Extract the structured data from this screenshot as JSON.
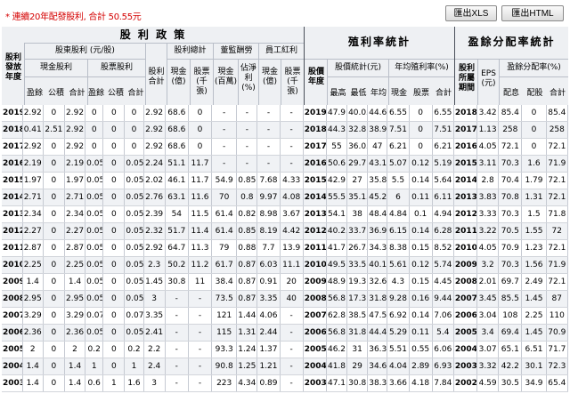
{
  "note": "* 連續20年配發股利, 合計 50.55元",
  "buttons": {
    "xls": "匯出XLS",
    "html": "匯出HTML"
  },
  "header": {
    "dividend": {
      "title": "股 利 政 策",
      "year": "股利發放年度",
      "shareholder": "股東股利 (元/股)",
      "cash": "現金股利",
      "stock": "股票股利",
      "surplus": "盈餘",
      "reserve": "公積",
      "total": "合計",
      "stock_total": "股利合計",
      "summary": "股利總計",
      "cash_amt": "現金(億)",
      "stock_amt": "股票(千張)",
      "director": "董監酬勞",
      "director_cash": "現金(百萬)",
      "director_ratio": "佔淨利(%)",
      "employee": "員工紅利",
      "employee_cash": "現金(億)",
      "employee_stock": "股票(千張)"
    },
    "yield": {
      "title": "殖利率統計",
      "year": "股價年度",
      "price_stats": "股價統計(元)",
      "high": "最高",
      "low": "最低",
      "avg": "年均",
      "avg_yield": "年均殖利率(%)",
      "cash": "現金",
      "stock": "股票",
      "total": "合計"
    },
    "payout": {
      "title": "盈餘分配率統計",
      "year": "股利所屬期間",
      "eps": "EPS (元)",
      "ratio": "盈餘分配率(%)",
      "cash": "配息",
      "stock": "配股",
      "total": "合計"
    }
  },
  "rows": [
    [
      "2019",
      "2.92",
      "0",
      "2.92",
      "0",
      "0",
      "0",
      "2.92",
      "68.6",
      "0",
      "-",
      "-",
      "-",
      "-",
      "2019",
      "47.9",
      "40.05",
      "44.6",
      "6.55",
      "0",
      "6.55",
      "2018",
      "3.42",
      "85.4",
      "0",
      "85.4"
    ],
    [
      "2018",
      "0.41",
      "2.51",
      "2.92",
      "0",
      "0",
      "0",
      "2.92",
      "68.6",
      "0",
      "-",
      "-",
      "-",
      "-",
      "2018",
      "44.3",
      "32.8",
      "38.9",
      "7.51",
      "0",
      "7.51",
      "2017",
      "1.13",
      "258",
      "0",
      "258"
    ],
    [
      "2017",
      "2.92",
      "0",
      "2.92",
      "0",
      "0",
      "0",
      "2.92",
      "68.6",
      "0",
      "-",
      "-",
      "-",
      "-",
      "2017",
      "55",
      "36.05",
      "47",
      "6.21",
      "0",
      "6.21",
      "2016",
      "4.05",
      "72.1",
      "0",
      "72.1"
    ],
    [
      "2016",
      "2.19",
      "0",
      "2.19",
      "0.05",
      "0",
      "0.05",
      "2.24",
      "51.1",
      "11.7",
      "-",
      "-",
      "-",
      "-",
      "2016",
      "50.6",
      "29.7",
      "43.1",
      "5.07",
      "0.12",
      "5.19",
      "2015",
      "3.11",
      "70.3",
      "1.6",
      "71.9"
    ],
    [
      "2015",
      "1.97",
      "0",
      "1.97",
      "0.05",
      "0",
      "0.05",
      "2.02",
      "46.1",
      "11.7",
      "54.9",
      "0.85",
      "7.68",
      "4.33",
      "2015",
      "42.9",
      "27",
      "35.8",
      "5.5",
      "0.14",
      "5.64",
      "2014",
      "2.8",
      "70.4",
      "1.79",
      "72.1"
    ],
    [
      "2014",
      "2.71",
      "0",
      "2.71",
      "0.05",
      "0",
      "0.05",
      "2.76",
      "63.1",
      "11.6",
      "70",
      "0.8",
      "9.97",
      "4.08",
      "2014",
      "55.5",
      "35.15",
      "45.2",
      "6",
      "0.11",
      "6.11",
      "2013",
      "3.83",
      "70.8",
      "1.31",
      "72.1"
    ],
    [
      "2013",
      "2.34",
      "0",
      "2.34",
      "0.05",
      "0",
      "0.05",
      "2.39",
      "54",
      "11.5",
      "61.4",
      "0.82",
      "8.98",
      "3.67",
      "2013",
      "54.1",
      "38",
      "48.4",
      "4.84",
      "0.1",
      "4.94",
      "2012",
      "3.33",
      "70.3",
      "1.5",
      "71.8"
    ],
    [
      "2012",
      "2.27",
      "0",
      "2.27",
      "0.05",
      "0",
      "0.05",
      "2.32",
      "51.7",
      "11.4",
      "61.4",
      "0.85",
      "8.19",
      "4.42",
      "2012",
      "40.25",
      "33.7",
      "36.9",
      "6.15",
      "0.14",
      "6.28",
      "2011",
      "3.22",
      "70.5",
      "1.55",
      "72"
    ],
    [
      "2011",
      "2.87",
      "0",
      "2.87",
      "0.05",
      "0",
      "0.05",
      "2.92",
      "64.7",
      "11.3",
      "79",
      "0.88",
      "7.7",
      "13.9",
      "2011",
      "41.7",
      "26.75",
      "34.3",
      "8.38",
      "0.15",
      "8.52",
      "2010",
      "4.05",
      "70.9",
      "1.23",
      "72.1"
    ],
    [
      "2010",
      "2.25",
      "0",
      "2.25",
      "0.05",
      "0",
      "0.05",
      "2.3",
      "50.2",
      "11.2",
      "61.7",
      "0.87",
      "6.03",
      "11.1",
      "2010",
      "49.5",
      "33.5",
      "40.1",
      "5.61",
      "0.12",
      "5.74",
      "2009",
      "3.2",
      "70.3",
      "1.56",
      "71.9"
    ],
    [
      "2009",
      "1.4",
      "0",
      "1.4",
      "0.05",
      "0",
      "0.05",
      "1.45",
      "30.8",
      "11",
      "38.4",
      "0.87",
      "0.91",
      "20",
      "2009",
      "48.9",
      "19.3",
      "32.6",
      "4.3",
      "0.15",
      "4.45",
      "2008",
      "2.01",
      "69.7",
      "2.49",
      "72.1"
    ],
    [
      "2008",
      "2.95",
      "0",
      "2.95",
      "0.05",
      "0",
      "0.05",
      "3",
      "-",
      "-",
      "73.5",
      "0.87",
      "3.35",
      "40",
      "2008",
      "56.8",
      "17.3",
      "31.8",
      "9.28",
      "0.16",
      "9.44",
      "2007",
      "3.45",
      "85.5",
      "1.45",
      "87"
    ],
    [
      "2007",
      "3.29",
      "0",
      "3.29",
      "0.07",
      "0",
      "0.07",
      "3.35",
      "-",
      "-",
      "121",
      "1.44",
      "4.06",
      "-",
      "2007",
      "62.8",
      "38.5",
      "47.5",
      "6.92",
      "0.14",
      "7.06",
      "2006",
      "3.04",
      "108",
      "2.25",
      "110"
    ],
    [
      "2006",
      "2.36",
      "0",
      "2.36",
      "0.05",
      "0",
      "0.05",
      "2.41",
      "-",
      "-",
      "115",
      "1.31",
      "2.44",
      "-",
      "2006",
      "56.8",
      "31.8",
      "44.4",
      "5.29",
      "0.11",
      "5.4",
      "2005",
      "3.4",
      "69.4",
      "1.45",
      "70.9"
    ],
    [
      "2005",
      "2",
      "0",
      "2",
      "0.2",
      "0",
      "0.2",
      "2.2",
      "-",
      "-",
      "93.3",
      "1.24",
      "1.37",
      "-",
      "2005",
      "46.2",
      "31",
      "36.3",
      "5.51",
      "0.55",
      "6.06",
      "2004",
      "3.07",
      "65.1",
      "6.51",
      "71.7"
    ],
    [
      "2004",
      "1.4",
      "0",
      "1.4",
      "1",
      "0",
      "1",
      "2.4",
      "-",
      "-",
      "90.8",
      "1.25",
      "1.21",
      "-",
      "2004",
      "41.8",
      "29",
      "34.6",
      "4.04",
      "2.89",
      "6.93",
      "2003",
      "3.32",
      "42.2",
      "30.1",
      "72.3"
    ],
    [
      "2003",
      "1.4",
      "0",
      "1.4",
      "0.6",
      "1",
      "1.6",
      "3",
      "-",
      "-",
      "223",
      "4.34",
      "0.89",
      "-",
      "2003",
      "47.1",
      "30.8",
      "38.3",
      "3.66",
      "4.18",
      "7.84",
      "2002",
      "4.59",
      "30.5",
      "34.9",
      "65.4"
    ]
  ]
}
